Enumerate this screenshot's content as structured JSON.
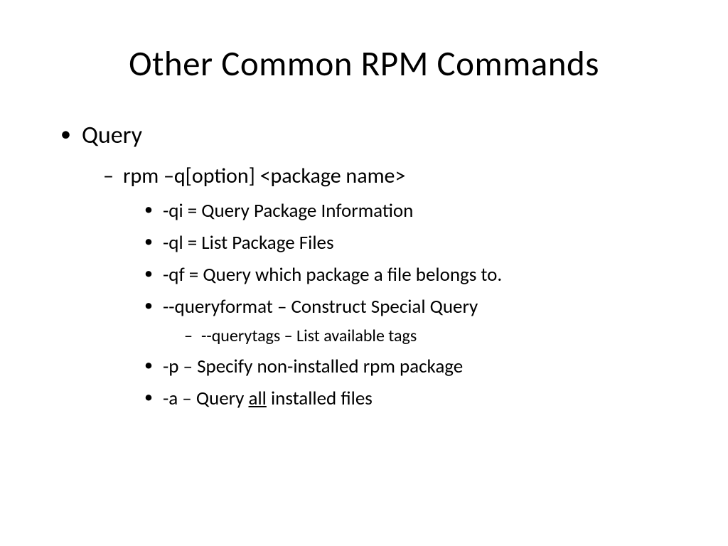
{
  "title": "Other Common RPM Commands",
  "bullets": {
    "query": "Query",
    "syntax": "rpm –q[option] <package name>",
    "qi": "-qi = Query Package Information",
    "ql": "-ql = List Package Files",
    "qf": "-qf = Query which package a file belongs to.",
    "queryformat": "--queryformat – Construct Special Query",
    "querytags": "--querytags – List available tags",
    "p": "-p – Specify non-installed rpm package",
    "a_pre": "-a – Query ",
    "a_underline": "all",
    "a_post": " installed files"
  }
}
